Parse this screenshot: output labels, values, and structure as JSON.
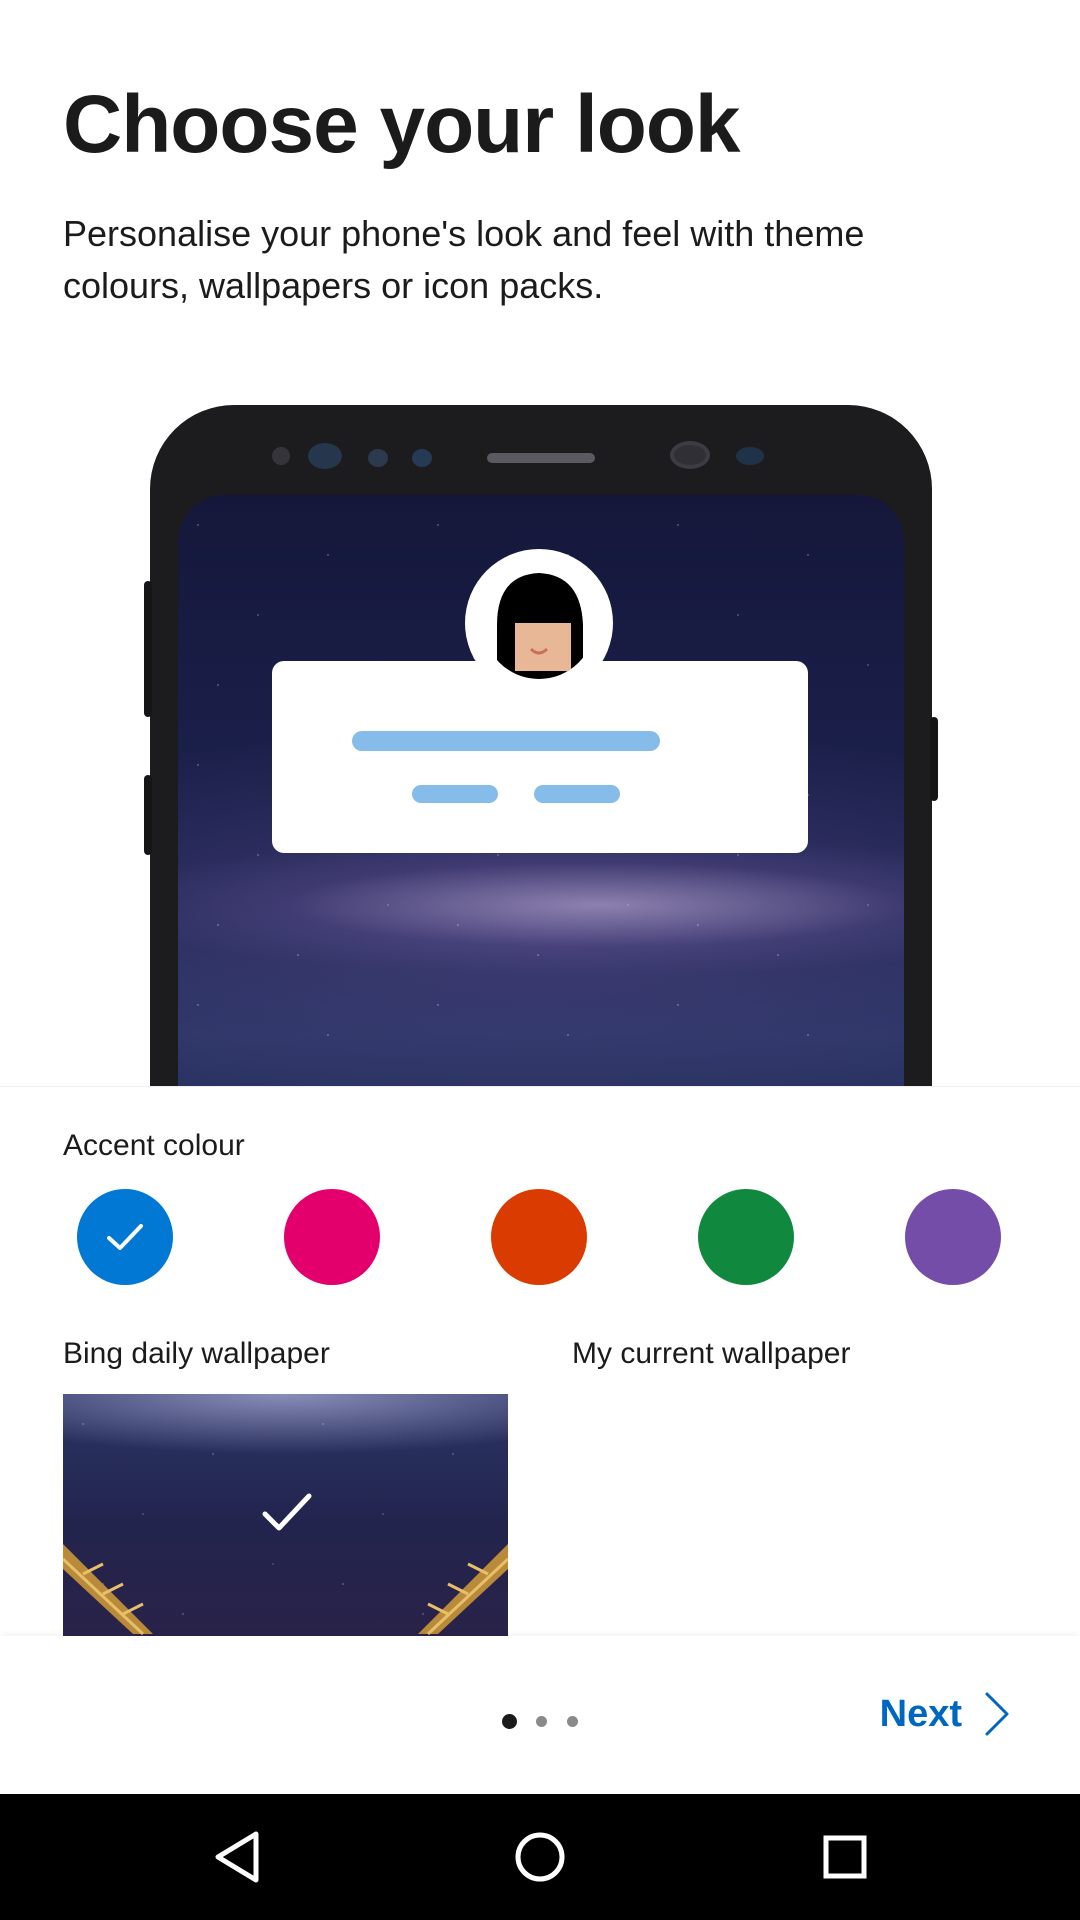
{
  "page": {
    "title": "Choose your look",
    "subtitle": "Personalise your phone's look and feel with theme colours, wallpapers or icon packs."
  },
  "accent": {
    "label": "Accent colour",
    "colors": [
      "#0078d4",
      "#e3006d",
      "#da3b01",
      "#10893e",
      "#744da9"
    ],
    "selected_index": 0
  },
  "wallpaper": {
    "bing_label": "Bing daily wallpaper",
    "current_label": "My current wallpaper",
    "selected": "bing"
  },
  "footer": {
    "next_label": "Next",
    "page_index": 1,
    "page_count": 3
  },
  "navbar": {
    "back_icon": "back-triangle-icon",
    "home_icon": "home-circle-icon",
    "recents_icon": "recents-square-icon"
  }
}
